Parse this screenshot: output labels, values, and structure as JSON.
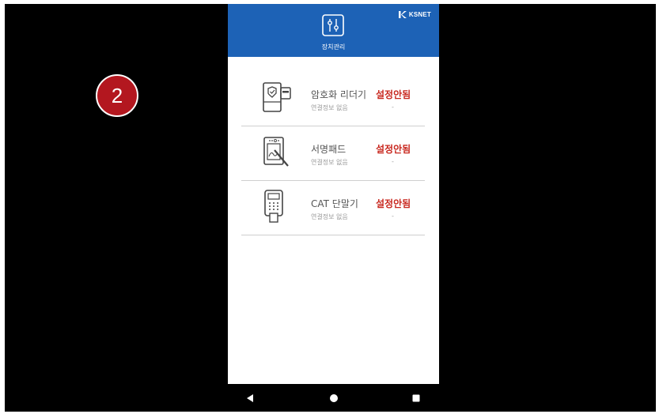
{
  "tutorial": {
    "step": "2"
  },
  "header": {
    "brand": "KSNET",
    "title": "장치관리",
    "settings_icon": "sliders-icon"
  },
  "devices": [
    {
      "name": "암호화 리더기",
      "status": "설정안됨",
      "info": "연결정보 없음",
      "value": "-",
      "icon": "card-reader-icon"
    },
    {
      "name": "서명패드",
      "status": "설정안됨",
      "info": "연결정보 없음",
      "value": "-",
      "icon": "signature-pad-icon"
    },
    {
      "name": "CAT 단말기",
      "status": "설정안됨",
      "info": "연결정보 없음",
      "value": "-",
      "icon": "cat-terminal-icon"
    }
  ],
  "nav": {
    "back": "back-icon",
    "home": "home-icon",
    "recent": "recent-apps-icon"
  },
  "colors": {
    "header": "#1d62b6",
    "status": "#c8281f",
    "badge": "#b3171f"
  }
}
